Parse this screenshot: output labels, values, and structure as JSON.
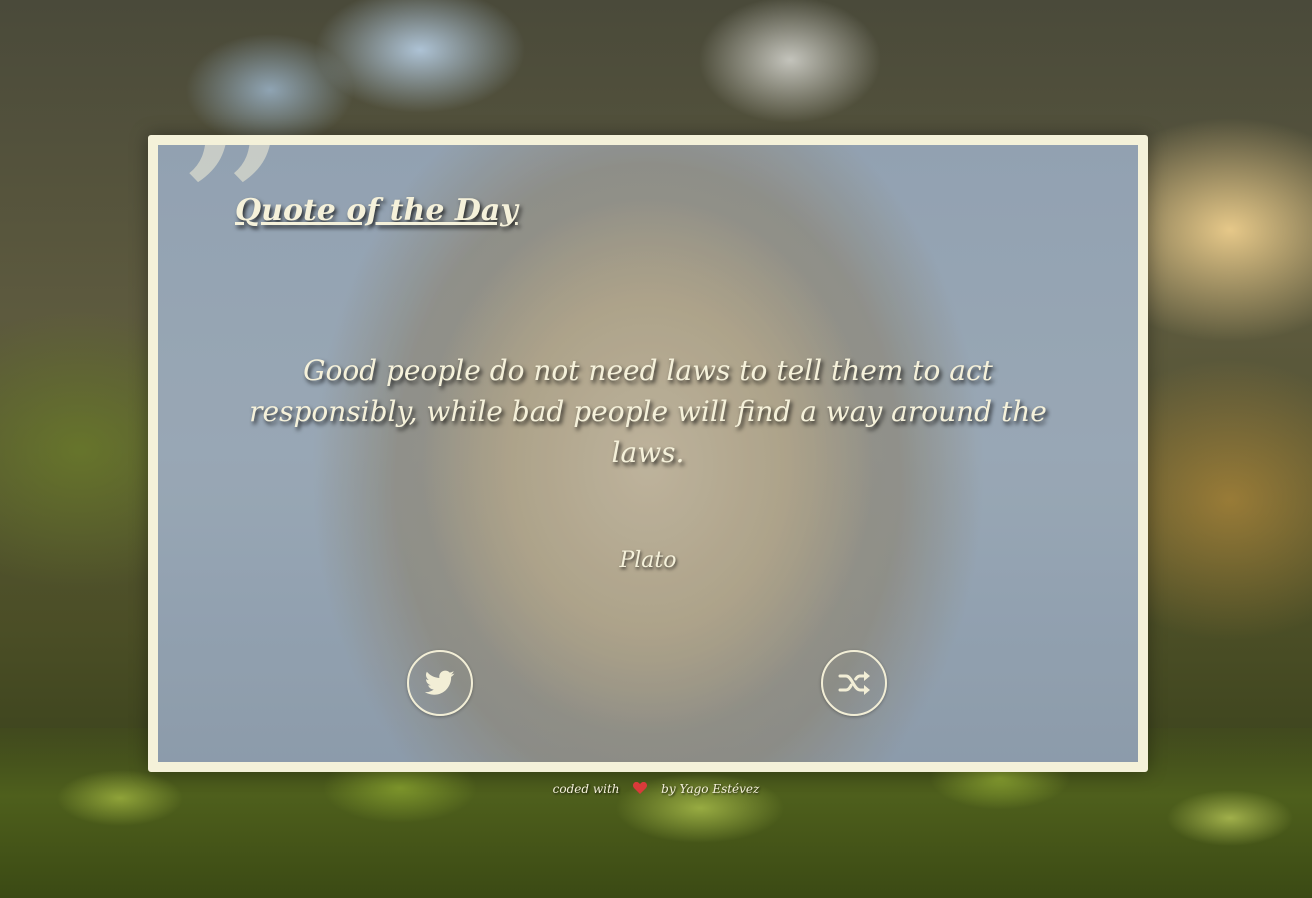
{
  "card": {
    "title": "Quote of the Day",
    "quote": "Good people do not need laws to tell them to act responsibly, while bad people will find a way around the laws.",
    "author": "Plato",
    "quote_mark": "”"
  },
  "buttons": {
    "tweet_icon": "twitter-icon",
    "new_quote_icon": "shuffle-icon"
  },
  "footer": {
    "coded_with": "coded with",
    "heart_icon": "heart-icon",
    "by": "by Yago Estévez"
  },
  "colors": {
    "text": "#f5f1da",
    "frame": "#f4f1d9",
    "heart": "#d93a3a"
  }
}
